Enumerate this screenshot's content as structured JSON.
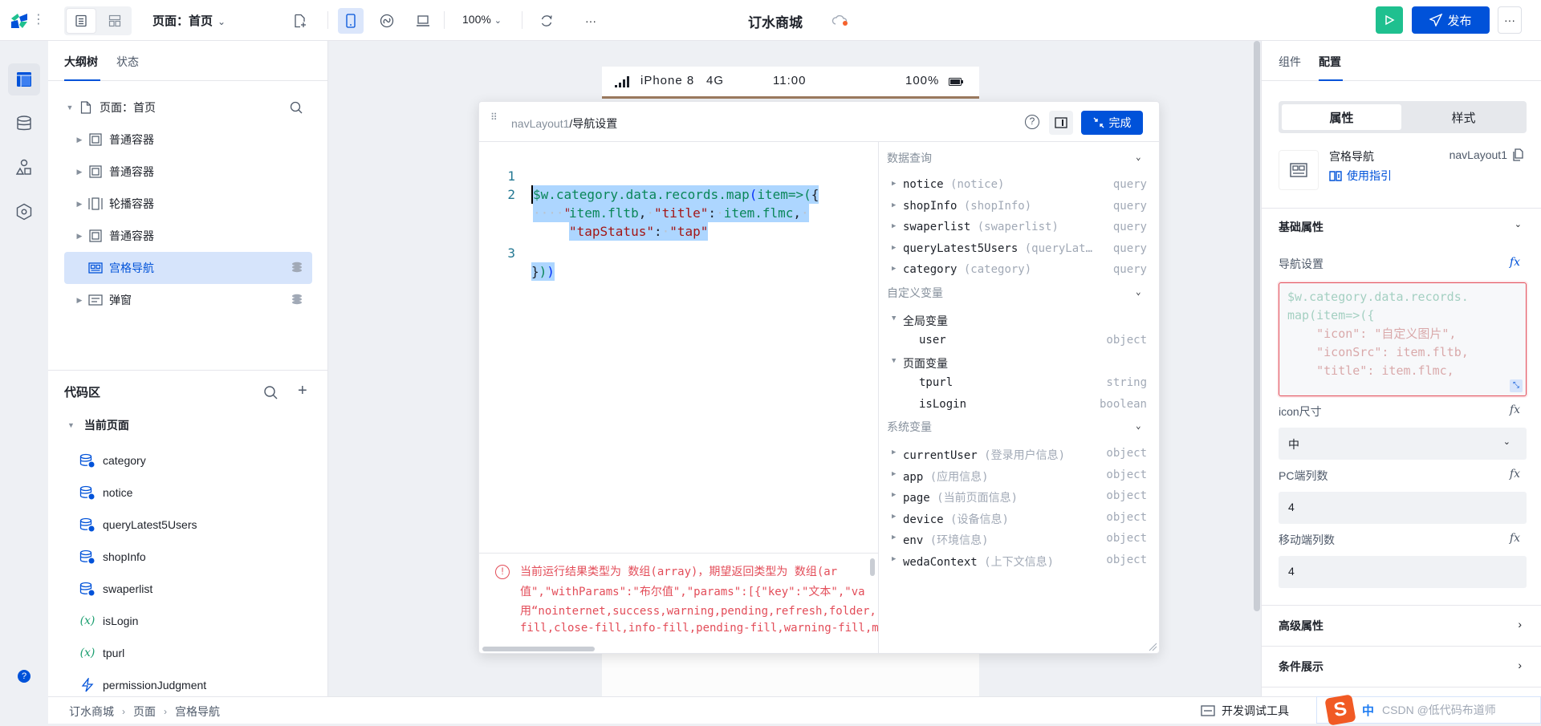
{
  "topbar": {
    "page_select": "页面：首页",
    "zoom": "100%",
    "app_title": "订水商城",
    "publish_label": "发布",
    "more_label": "···"
  },
  "left_panel": {
    "tabs": [
      {
        "label": "大纲树",
        "active": true
      },
      {
        "label": "状态",
        "active": false
      }
    ],
    "tree": [
      {
        "label": "页面：首页",
        "icon": "page-icon",
        "expanded": true
      },
      {
        "label": "普通容器",
        "icon": "container-icon"
      },
      {
        "label": "普通容器",
        "icon": "container-icon"
      },
      {
        "label": "轮播容器",
        "icon": "carousel-icon"
      },
      {
        "label": "普通容器",
        "icon": "container-icon"
      },
      {
        "label": "宫格导航",
        "icon": "grid-nav-icon",
        "selected": true
      },
      {
        "label": "弹窗",
        "icon": "modal-icon"
      }
    ],
    "code_area": {
      "title": "代码区",
      "group": "当前页面",
      "items": [
        {
          "label": "category",
          "icon": "query-icon"
        },
        {
          "label": "notice",
          "icon": "query-icon"
        },
        {
          "label": "queryLatest5Users",
          "icon": "query-icon"
        },
        {
          "label": "shopInfo",
          "icon": "query-icon"
        },
        {
          "label": "swaperlist",
          "icon": "query-icon"
        },
        {
          "label": "isLogin",
          "icon": "variable-icon"
        },
        {
          "label": "tpurl",
          "icon": "variable-icon"
        },
        {
          "label": "permissionJudgment",
          "icon": "function-icon"
        }
      ]
    }
  },
  "breadcrumb": [
    "订水商城",
    "页面",
    "宫格导航"
  ],
  "phone": {
    "carrier": "iPhone 8",
    "network": "4G",
    "time": "11:00",
    "battery": "100%"
  },
  "editor": {
    "path": "navLayout1",
    "title": "/导航设置",
    "done_label": "完成",
    "lines": [
      {
        "num": "1",
        "text": "$w.category.data.records.map(item=>({"
      },
      {
        "num": "2",
        "text": "\"icon\": \"自定义图片\", \"iconSrc\": item.fltb, \"title\": item.flmc, \"tapStatus\": \"tap\""
      },
      {
        "num": "3",
        "text": "}))"
      }
    ],
    "error_lines": [
      "当前运行结果类型为 数组(array)，期望返回类型为 数组(ar",
      "值\",\"withParams\":\"布尔值\",\"params\":[{\"key\":\"文本\",\"va",
      "用“nointernet,success,warning,pending,refresh,folder,",
      "fill,close-fill,info-fill,pending-fill,warning-fill,m"
    ]
  },
  "variables": {
    "sections": [
      {
        "title": "数据查询",
        "rows": [
          {
            "name": "notice",
            "alias": "(notice)",
            "type": "query"
          },
          {
            "name": "shopInfo",
            "alias": "(shopInfo)",
            "type": "query"
          },
          {
            "name": "swaperlist",
            "alias": "(swaperlist)",
            "type": "query"
          },
          {
            "name": "queryLatest5Users",
            "alias": "(queryLat…",
            "type": "query"
          },
          {
            "name": "category",
            "alias": "(category)",
            "type": "query"
          }
        ]
      },
      {
        "title": "自定义变量",
        "groups": [
          {
            "name": "全局变量",
            "rows": [
              {
                "name": "user",
                "type": "object"
              }
            ]
          },
          {
            "name": "页面变量",
            "rows": [
              {
                "name": "tpurl",
                "type": "string"
              },
              {
                "name": "isLogin",
                "type": "boolean"
              }
            ]
          }
        ]
      },
      {
        "title": "系统变量",
        "rows": [
          {
            "name": "currentUser",
            "alias": "(登录用户信息)",
            "type": "object"
          },
          {
            "name": "app",
            "alias": "(应用信息)",
            "type": "object"
          },
          {
            "name": "page",
            "alias": "(当前页面信息)",
            "type": "object"
          },
          {
            "name": "device",
            "alias": "(设备信息)",
            "type": "object"
          },
          {
            "name": "env",
            "alias": "(环境信息)",
            "type": "object"
          },
          {
            "name": "wedaContext",
            "alias": "(上下文信息)",
            "type": "object"
          }
        ]
      }
    ]
  },
  "right_panel": {
    "tabs": [
      {
        "label": "组件",
        "active": false
      },
      {
        "label": "配置",
        "active": true
      }
    ],
    "segments": [
      {
        "label": "属性",
        "active": true
      },
      {
        "label": "样式",
        "active": false
      }
    ],
    "component": {
      "name": "宫格导航",
      "guide": "使用指引",
      "id": "navLayout1"
    },
    "basic_title": "基础属性",
    "fields": {
      "nav_label": "导航设置",
      "nav_code": [
        "$w.category.data.records.",
        "map(item=>({",
        "    \"icon\": \"自定义图片\",",
        "    \"iconSrc\": item.fltb,",
        "    \"title\": item.flmc,"
      ],
      "icon_size_label": "icon尺寸",
      "icon_size_value": "中",
      "pc_cols_label": "PC端列数",
      "pc_cols_value": "4",
      "mobile_cols_label": "移动端列数",
      "mobile_cols_value": "4"
    },
    "advanced_title": "高级属性",
    "condition_title": "条件展示",
    "fx_label": "fx"
  },
  "footer": {
    "devtools_label": "开发调试工具",
    "ime_text": "中",
    "watermark": "CSDN @低代码布道师"
  }
}
